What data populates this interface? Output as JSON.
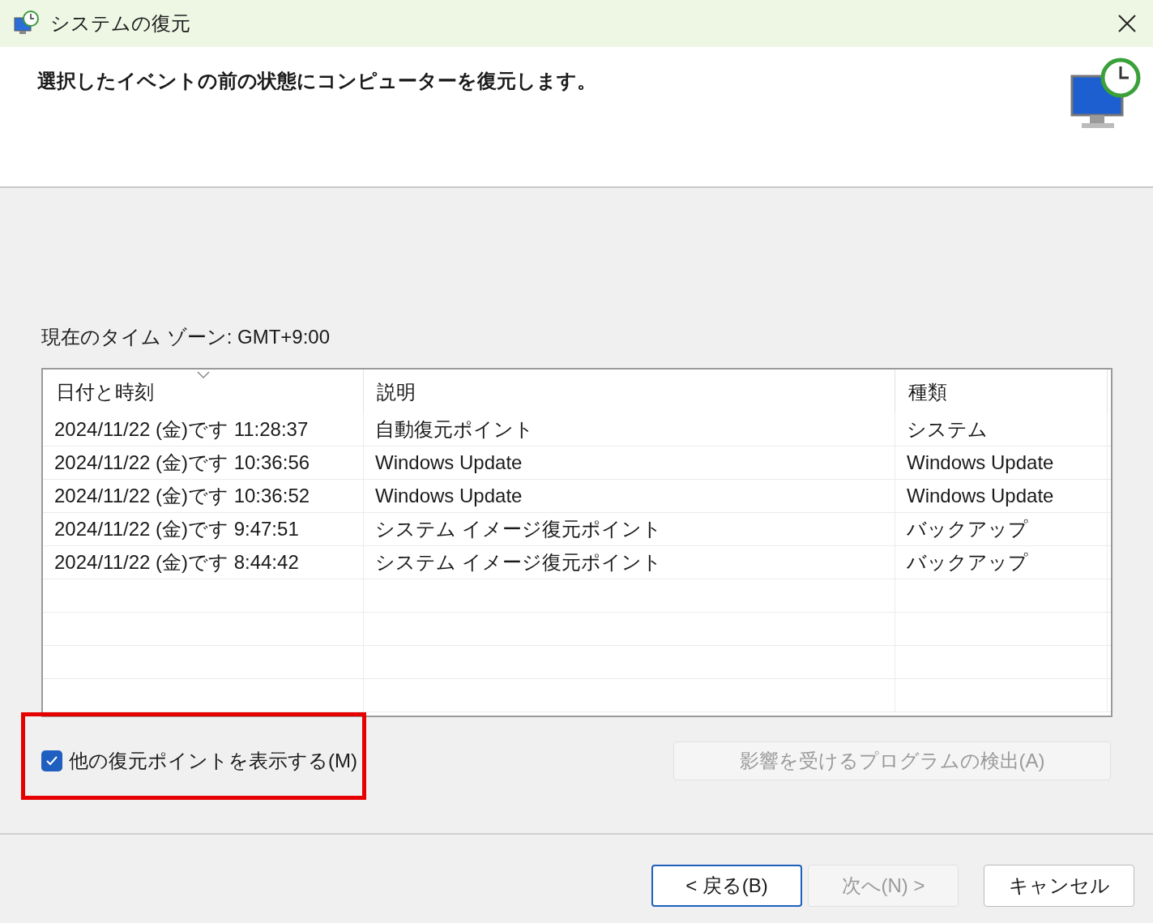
{
  "window": {
    "title": "システムの復元"
  },
  "header": {
    "instruction": "選択したイベントの前の状態にコンピューターを復元します。"
  },
  "timezone": "現在のタイム ゾーン: GMT+9:00",
  "table": {
    "columns": [
      {
        "label": "日付と時刻",
        "sorted": true
      },
      {
        "label": "説明",
        "sorted": false
      },
      {
        "label": "種類",
        "sorted": false
      }
    ],
    "rows": [
      [
        "2024/11/22 (金)です 11:28:37",
        "自動復元ポイント",
        "システム"
      ],
      [
        "2024/11/22 (金)です 10:36:56",
        "Windows Update",
        "Windows Update"
      ],
      [
        "2024/11/22 (金)です 10:36:52",
        "Windows Update",
        "Windows Update"
      ],
      [
        "2024/11/22 (金)です 9:47:51",
        "システム イメージ復元ポイント",
        "バックアップ"
      ],
      [
        "2024/11/22 (金)です 8:44:42",
        "システム イメージ復元ポイント",
        "バックアップ"
      ]
    ]
  },
  "show_more": {
    "label": "他の復元ポイントを表示する(M)",
    "checked": true
  },
  "scan_button": {
    "label": "影響を受けるプログラムの検出(A)",
    "disabled": true
  },
  "buttons": [
    {
      "label": "< 戻る(B)",
      "disabled": false,
      "default": true
    },
    {
      "label": "次へ(N) >",
      "disabled": true,
      "default": false
    },
    {
      "label": "キャンセル",
      "disabled": false,
      "default": false
    }
  ]
}
